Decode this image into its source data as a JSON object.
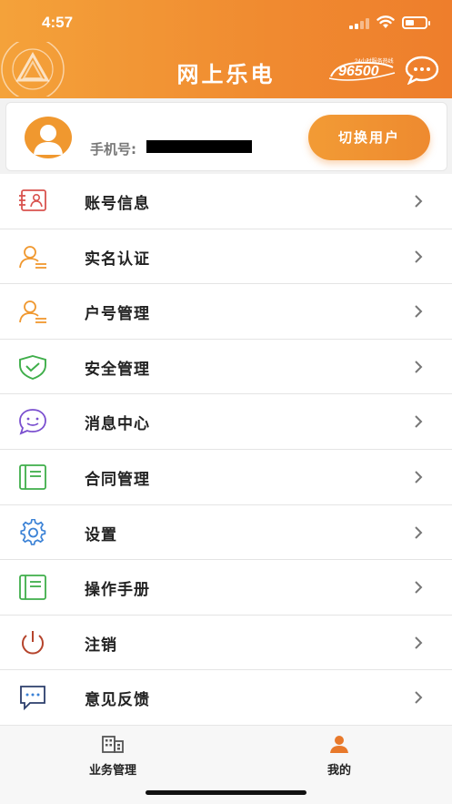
{
  "status_bar": {
    "time": "4:57"
  },
  "header": {
    "title": "网上乐电",
    "hotline_number": "96500",
    "hotline_tag": "24小时服务热线",
    "brand_color": "#f08a30"
  },
  "profile": {
    "phone_label": "手机号:",
    "switch_user_label": "切换用户"
  },
  "menu": {
    "items": [
      {
        "label": "账号信息",
        "icon": "id-card-icon"
      },
      {
        "label": "实名认证",
        "icon": "user-verify-icon"
      },
      {
        "label": "户号管理",
        "icon": "account-user-icon"
      },
      {
        "label": "安全管理",
        "icon": "shield-icon"
      },
      {
        "label": "消息中心",
        "icon": "message-icon"
      },
      {
        "label": "合同管理",
        "icon": "contract-icon"
      },
      {
        "label": "设置",
        "icon": "gear-icon"
      },
      {
        "label": "操作手册",
        "icon": "manual-icon"
      },
      {
        "label": "注销",
        "icon": "power-icon"
      },
      {
        "label": "意见反馈",
        "icon": "feedback-icon"
      }
    ]
  },
  "tabbar": {
    "tabs": [
      {
        "label": "业务管理",
        "icon": "building-icon",
        "active": false
      },
      {
        "label": "我的",
        "icon": "person-icon",
        "active": true
      }
    ],
    "active_color": "#e8792b"
  }
}
